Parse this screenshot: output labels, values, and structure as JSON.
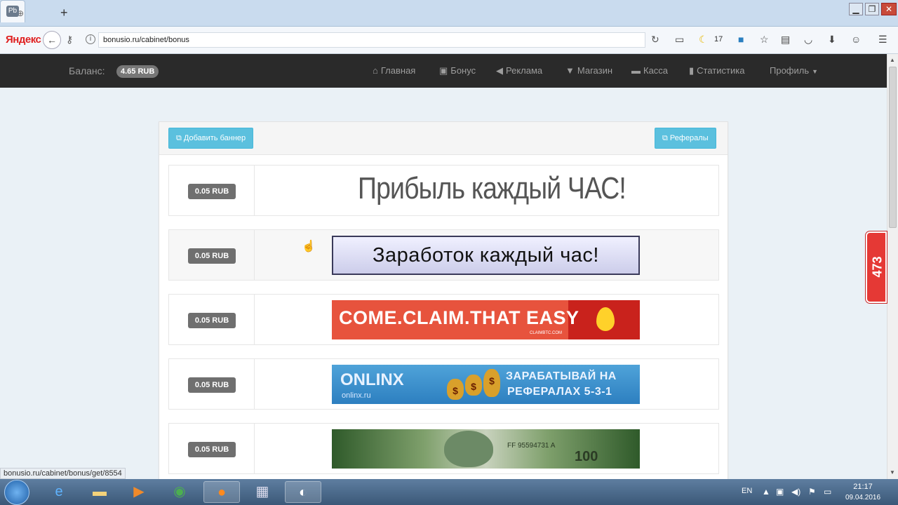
{
  "browser": {
    "logo": "Яндекс",
    "tab_label": "Pb",
    "url": "bonusio.ru/cabinet/bonus",
    "toolbar_count": "17"
  },
  "site": {
    "balance_label": "Баланс:",
    "balance_value": "4.65 RUB",
    "nav": [
      "Главная",
      "Бонус",
      "Реклама",
      "Магазин",
      "Касса",
      "Статистика",
      "Профиль"
    ],
    "add_banner_label": "Добавить баннер",
    "referrals_label": "Рефералы"
  },
  "rows": [
    {
      "price": "0.05 RUB",
      "banner_text": "Прибыль каждый ЧАС!"
    },
    {
      "price": "0.05 RUB",
      "banner_text": "Заработок каждый час!"
    },
    {
      "price": "0.05 RUB",
      "banner_text": "COME.CLAIM.THAT EASY",
      "banner_sub": "CLAIMBTC.COM"
    },
    {
      "price": "0.05 RUB",
      "banner_text": "ONLINX",
      "banner_sub": "onlinx.ru",
      "banner_right_1": "ЗАРАБАТЫВАЙ НА",
      "banner_right_2": "РЕФЕРАЛАХ 5-3-1"
    },
    {
      "price": "0.05 RUB",
      "banner_serial": "FF 95594731 A",
      "banner_number": "100"
    }
  ],
  "side_widget_count": "473",
  "status_url": "bonusio.ru/cabinet/bonus/get/8554",
  "taskbar": {
    "lang": "EN",
    "time": "21:17",
    "date": "09.04.2016"
  },
  "colors": {
    "nav_bg": "#2a2a2a",
    "btn_info": "#5bc0de",
    "price_badge": "#6f6f6f",
    "widget_red": "#e53935"
  }
}
